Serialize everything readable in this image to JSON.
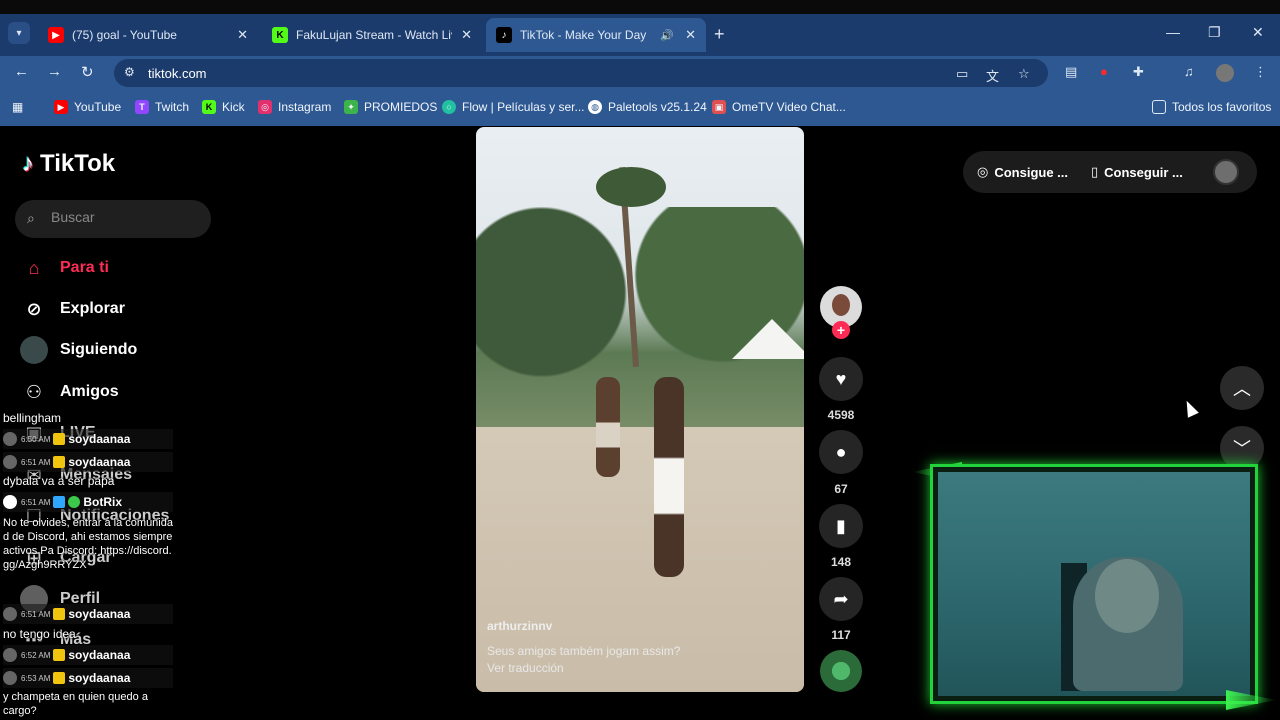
{
  "browser": {
    "tabs": [
      {
        "title": "(75) goal - YouTube",
        "favicon": "youtube-icon",
        "color": "#ff0000"
      },
      {
        "title": "FakuLujan Stream - Watch Live",
        "favicon": "kick-icon",
        "color": "#53fc18"
      },
      {
        "title": "TikTok - Make Your Day",
        "favicon": "tiktok-icon",
        "color": "#000000"
      }
    ],
    "url": "tiktok.com",
    "bookmarks": [
      {
        "label": "YouTube",
        "icon": "youtube-icon",
        "color": "#ff0000"
      },
      {
        "label": "Twitch",
        "icon": "twitch-icon",
        "color": "#9146ff"
      },
      {
        "label": "Kick",
        "icon": "kick-icon",
        "color": "#53fc18"
      },
      {
        "label": "Instagram",
        "icon": "instagram-icon",
        "color": "#e1306c"
      },
      {
        "label": "PROMIEDOS",
        "icon": "promiedos-icon",
        "color": "#3cb44b"
      },
      {
        "label": "Flow | Películas y ser...",
        "icon": "flow-icon",
        "color": "#20c0a0"
      },
      {
        "label": "Paletools v25.1.24",
        "icon": "globe-icon",
        "color": "#ffffff"
      },
      {
        "label": "OmeTV Video Chat...",
        "icon": "ometv-icon",
        "color": "#e05050"
      }
    ],
    "all_bookmarks": "Todos los favoritos"
  },
  "tiktok": {
    "logo": "TikTok",
    "search_placeholder": "Buscar",
    "nav": [
      {
        "label": "Para ti",
        "icon": "home-icon"
      },
      {
        "label": "Explorar",
        "icon": "compass-icon"
      },
      {
        "label": "Siguiendo",
        "icon": "following-icon"
      },
      {
        "label": "Amigos",
        "icon": "friends-icon"
      },
      {
        "label": "LIVE",
        "icon": "live-icon"
      },
      {
        "label": "Mensajes",
        "icon": "messages-icon"
      },
      {
        "label": "Notificaciones",
        "icon": "notifications-icon"
      },
      {
        "label": "Cargar",
        "icon": "upload-icon"
      },
      {
        "label": "Perfil",
        "icon": "profile-icon"
      },
      {
        "label": "Más",
        "icon": "more-icon"
      }
    ],
    "top_right": {
      "coins": "Consigue ...",
      "app": "Conseguir ..."
    },
    "video": {
      "author": "arthurzinnv",
      "caption": "Seus amigos também jogam assim?",
      "translate": "Ver traducción"
    },
    "actions": {
      "likes": "4598",
      "comments": "67",
      "saves": "148",
      "shares": "117"
    },
    "accent": "#fe2c55"
  },
  "chat": {
    "top": "bellingham",
    "messages": [
      {
        "time": "6:50 AM",
        "user": "soydaanaa",
        "text": ""
      },
      {
        "time": "6:51 AM",
        "user": "soydaanaa",
        "text": "dybala va a ser papa"
      },
      {
        "time": "6:51 AM",
        "user": "BotRix",
        "text": "No te olvides, entrar a la comunidad de Discord, ahi estamos siempre activos Pa Discord: https://discord.gg/Azgh9RRYZX"
      },
      {
        "time": "6:51 AM",
        "user": "soydaanaa",
        "text": "no tengo idea"
      },
      {
        "time": "6:52 AM",
        "user": "soydaanaa",
        "text": ""
      },
      {
        "time": "6:53 AM",
        "user": "soydaanaa",
        "text": "y champeta en quien quedo a cargo?"
      }
    ]
  },
  "webcam": {
    "border_color": "#22d23a"
  }
}
